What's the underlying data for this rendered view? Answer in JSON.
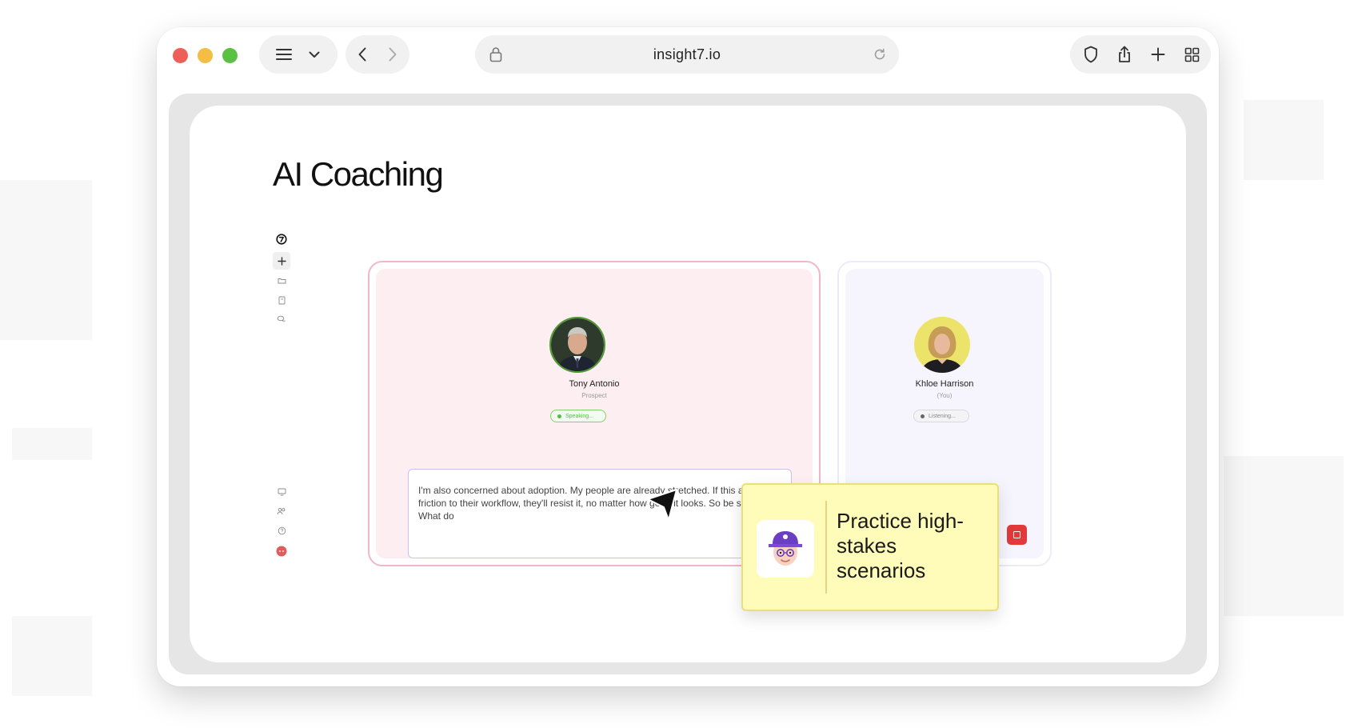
{
  "browser": {
    "url": "insight7.io",
    "traffic_lights": {
      "close": "#ee5f57",
      "minimize": "#f4bd43",
      "maximize": "#5bc144"
    }
  },
  "page": {
    "title": "AI Coaching"
  },
  "sidebar": {
    "top_icons": [
      "logo-icon",
      "plus-icon",
      "folder-icon",
      "book-icon",
      "chat-icon"
    ],
    "bottom_icons": [
      "monitor-icon",
      "users-icon",
      "help-icon",
      "user-avatar"
    ]
  },
  "prospect": {
    "name": "Tony Antonio",
    "role": "Prospect",
    "status": "Speaking...",
    "transcript": "I'm also concerned about adoption. My people are already stretched. If this adds friction to their workflow, they'll resist it, no matter how good it looks. So be specific. What do"
  },
  "you": {
    "name": "Khloe Harrison",
    "role": "(You)",
    "status": "Listening..."
  },
  "callout": {
    "text": "Practice high-stakes scenarios"
  },
  "colors": {
    "prospect_border": "#f1b7c8",
    "prospect_bg": "#fdeef2",
    "you_bg": "#f6f5fd",
    "speaking_green": "#4cc43a",
    "stop_red": "#e2393b",
    "callout_bg": "#fffbb8"
  }
}
